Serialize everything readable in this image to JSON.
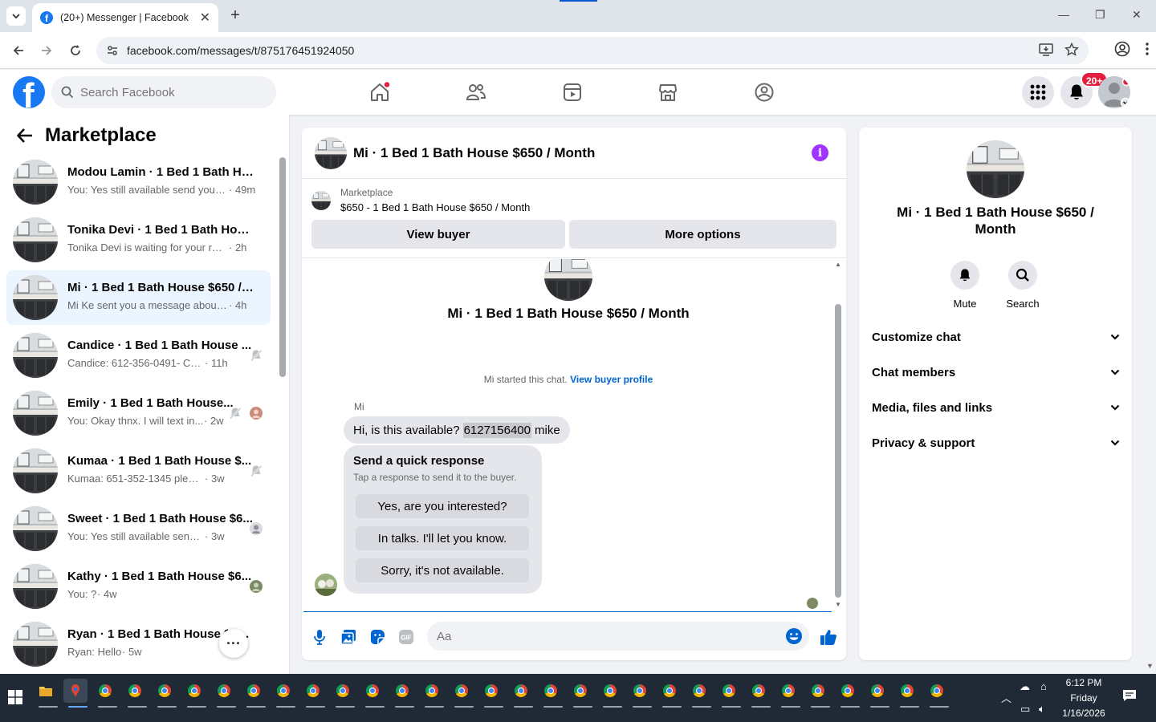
{
  "browser": {
    "tab_title": "(20+) Messenger | Facebook",
    "url": "facebook.com/messages/t/875176451924050"
  },
  "header": {
    "search_placeholder": "Search Facebook",
    "notification_badge": "20+"
  },
  "sidebar": {
    "title": "Marketplace",
    "conversations": [
      {
        "name": "Modou Lamin · 1 Bed 1 Bath Ho...",
        "preview": "You: Yes still available send your c...",
        "time": "· 49m",
        "side": ""
      },
      {
        "name": "Tonika Devi · 1 Bed 1 Bath House...",
        "preview": "Tonika Devi is waiting for your resp...",
        "time": "· 2h",
        "side": ""
      },
      {
        "name": "Mi · 1 Bed 1 Bath House $650 / ...",
        "preview": "Mi Ke sent you a message about yo...",
        "time": "· 4h",
        "side": ""
      },
      {
        "name": "Candice · 1 Bed 1 Bath House ...",
        "preview": "Candice: 612-356-0491- Cody",
        "time": "· 11h",
        "side": "muted"
      },
      {
        "name": "Emily · 1 Bed 1 Bath House...",
        "preview": "You: Okay thnx. I will text in...",
        "time": "· 2w",
        "side": "muted+avatar"
      },
      {
        "name": "Kumaa · 1 Bed 1 Bath House $...",
        "preview": "Kumaa: 651-352-1345 please",
        "time": "· 3w",
        "side": "muted"
      },
      {
        "name": "Sweet · 1 Bed 1 Bath House $6...",
        "preview": "You: Yes still available send your...",
        "time": "· 3w",
        "side": "avatar"
      },
      {
        "name": "Kathy · 1 Bed 1 Bath House $6...",
        "preview": "You: ?",
        "time": "· 4w",
        "side": "avatar"
      },
      {
        "name": "Ryan · 1 Bed 1 Bath House $65...",
        "preview": "Ryan: Hello",
        "time": "· 5w",
        "side": ""
      }
    ],
    "more_label": "···"
  },
  "chat": {
    "title": "Mi · 1 Bed 1 Bath House $650 / Month",
    "listing_source": "Marketplace",
    "listing_title": "$650 - 1 Bed 1 Bath House $650 / Month",
    "view_buyer": "View buyer",
    "more_options": "More options",
    "intro_title": "Mi · 1 Bed 1 Bath House $650 / Month",
    "started_text": "Mi started this chat.",
    "buyer_profile_link": "View buyer profile",
    "sender": "Mi",
    "message_before": "Hi, is this available?",
    "message_phone": "6127156400",
    "message_after": "mike",
    "quick_title": "Send a quick response",
    "quick_subtitle": "Tap a response to send it to the buyer.",
    "quick_responses": [
      "Yes, are you interested?",
      "In talks. I'll let you know.",
      "Sorry, it's not available."
    ],
    "input_placeholder": "Aa"
  },
  "info_panel": {
    "title": "Mi · 1 Bed 1 Bath House $650 / Month",
    "mute": "Mute",
    "search": "Search",
    "sections": [
      "Customize chat",
      "Chat members",
      "Media, files and links",
      "Privacy & support"
    ]
  },
  "taskbar": {
    "time": "6:12 PM",
    "day": "Friday",
    "date": "1/16/2026"
  },
  "colors": {
    "fb_blue": "#1877f2",
    "messenger_purple": "#a033ff",
    "link_blue": "#0064d1",
    "badge_red": "#e41e3f"
  }
}
